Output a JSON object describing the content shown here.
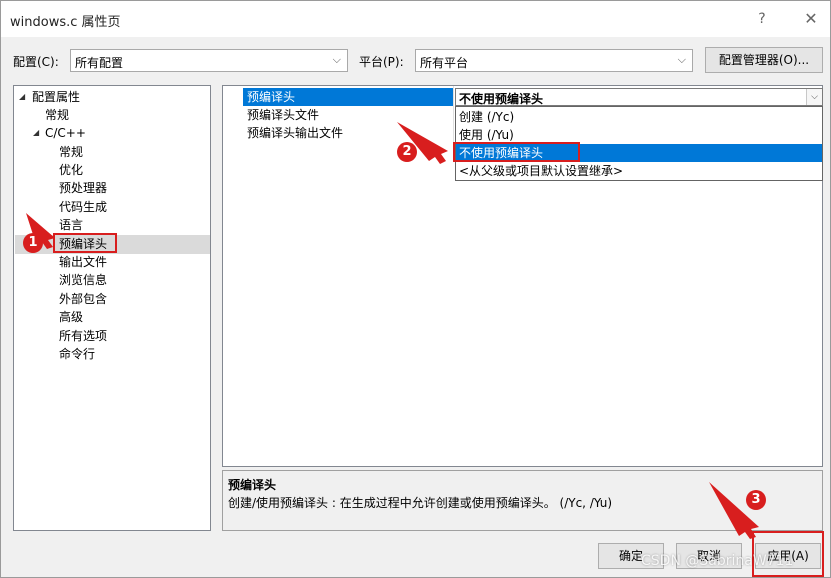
{
  "window": {
    "title": "windows.c 属性页",
    "help_icon": "?",
    "close_icon": "✕"
  },
  "toolbar": {
    "config_label": "配置(C):",
    "config_value": "所有配置",
    "platform_label": "平台(P):",
    "platform_value": "所有平台",
    "config_manager_button": "配置管理器(O)..."
  },
  "tree": {
    "root": "配置属性",
    "general": "常规",
    "cpp": "C/C++",
    "children": [
      "常规",
      "优化",
      "预处理器",
      "代码生成",
      "语言",
      "预编译头",
      "输出文件",
      "浏览信息",
      "外部包含",
      "高级",
      "所有选项",
      "命令行"
    ]
  },
  "grid": {
    "rows": [
      "预编译头",
      "预编译头文件",
      "预编译头输出文件"
    ],
    "current_value": "不使用预编译头",
    "dropdown_options": [
      "创建 (/Yc)",
      "使用 (/Yu)",
      "不使用预编译头",
      "<从父级或项目默认设置继承>"
    ]
  },
  "description": {
    "title": "预编译头",
    "text": "创建/使用预编译头 : 在生成过程中允许创建或使用预编译头。      (/Yc, /Yu)"
  },
  "buttons": {
    "ok": "确定",
    "cancel": "取消",
    "apply": "应用(A)"
  },
  "annotations": {
    "badges": [
      "1",
      "2",
      "3"
    ],
    "color": "#d81e1e"
  },
  "watermark": "CSDN @SabrinaW711"
}
